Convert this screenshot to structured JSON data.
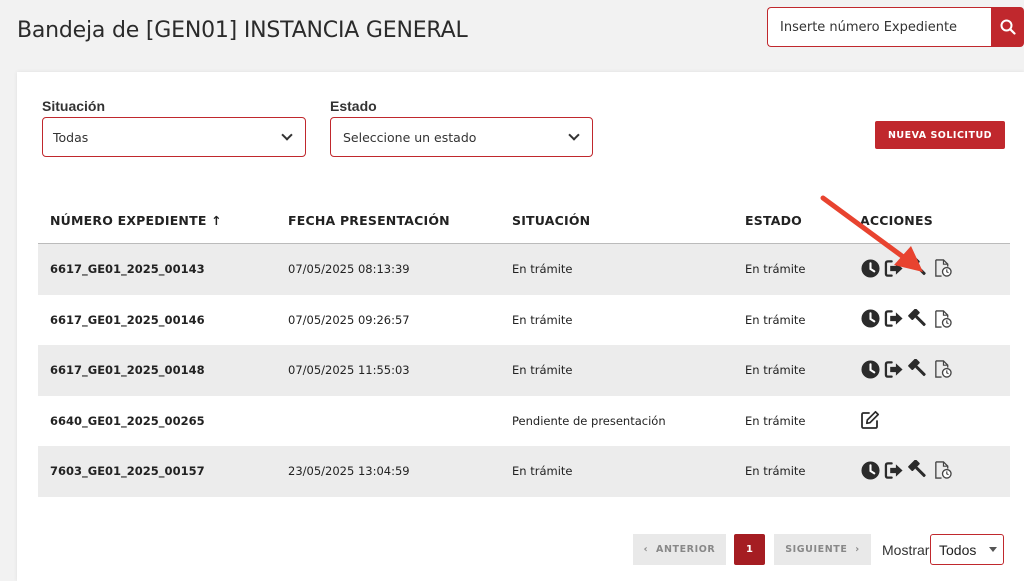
{
  "header": {
    "title": "Bandeja de [GEN01] INSTANCIA GENERAL",
    "search_placeholder": "Inserte número Expediente"
  },
  "filters": {
    "situacion_label": "Situación",
    "situacion_value": "Todas",
    "estado_label": "Estado",
    "estado_value": "Seleccione un estado",
    "new_button": "NUEVA SOLICITUD"
  },
  "table": {
    "columns": [
      "NÚMERO EXPEDIENTE ↑",
      "FECHA PRESENTACIÓN",
      "SITUACIÓN",
      "ESTADO",
      "ACCIONES"
    ],
    "rows": [
      {
        "numero": "6617_GE01_2025_00143",
        "fecha": "07/05/2025 08:13:39",
        "situacion": "En trámite",
        "estado": "En trámite"
      },
      {
        "numero": "6617_GE01_2025_00146",
        "fecha": "07/05/2025 09:26:57",
        "situacion": "En trámite",
        "estado": "En trámite"
      },
      {
        "numero": "6617_GE01_2025_00148",
        "fecha": "07/05/2025 11:55:03",
        "situacion": "En trámite",
        "estado": "En trámite"
      },
      {
        "numero": "6640_GE01_2025_00265",
        "fecha": "",
        "situacion": "Pendiente de presentación",
        "estado": "En trámite"
      },
      {
        "numero": "7603_GE01_2025_00157",
        "fecha": "23/05/2025 13:04:59",
        "situacion": "En trámite",
        "estado": "En trámite"
      }
    ],
    "row_actions": [
      [
        "clock-icon",
        "sign-out-icon",
        "gavel-icon",
        "document-clock-icon"
      ],
      [
        "clock-icon",
        "sign-out-icon",
        "gavel-icon",
        "document-clock-icon"
      ],
      [
        "clock-icon",
        "sign-out-icon",
        "gavel-icon",
        "document-clock-icon"
      ],
      [
        "edit-icon"
      ],
      [
        "clock-icon",
        "sign-out-icon",
        "gavel-icon",
        "document-clock-icon"
      ]
    ]
  },
  "pagination": {
    "prev": "ANTERIOR",
    "page": "1",
    "next": "SIGUIENTE",
    "show_label": "Mostrar",
    "show_value": "Todos"
  },
  "colors": {
    "accent": "#c0282d",
    "row_shade": "#ececec",
    "annotation_arrow": "#e8432f"
  }
}
